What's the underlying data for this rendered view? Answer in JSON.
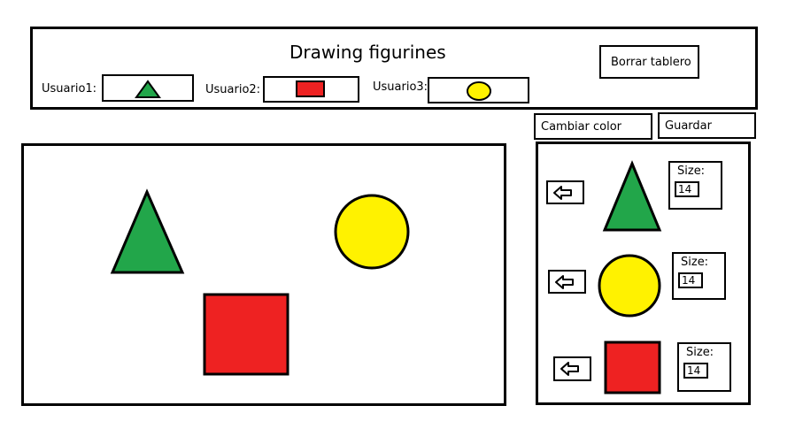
{
  "header": {
    "title": "Drawing figurines",
    "clear_button": "Borrar tablero",
    "users": [
      {
        "label": "Usuario1:",
        "shape": "triangle",
        "color": "#22A64A"
      },
      {
        "label": "Usuario2:",
        "shape": "square",
        "color": "#EE2222"
      },
      {
        "label": "Usuario3:",
        "shape": "circle",
        "color": "#FFF200"
      }
    ]
  },
  "toolbar": {
    "change_color_button": "Cambiar color",
    "save_button": "Guardar"
  },
  "canvas": {
    "shapes": [
      {
        "type": "triangle",
        "color": "#22A64A"
      },
      {
        "type": "circle",
        "color": "#FFF200"
      },
      {
        "type": "square",
        "color": "#EE2222"
      }
    ]
  },
  "palette": {
    "items": [
      {
        "shape": "triangle",
        "color": "#22A64A",
        "size_label": "Size:",
        "size_value": "14",
        "add_icon": "arrow-left-icon"
      },
      {
        "shape": "circle",
        "color": "#FFF200",
        "size_label": "Size:",
        "size_value": "14",
        "add_icon": "arrow-left-icon"
      },
      {
        "shape": "square",
        "color": "#EE2222",
        "size_label": "Size:",
        "size_value": "14",
        "add_icon": "arrow-left-icon"
      }
    ]
  },
  "colors": {
    "green": "#22A64A",
    "red": "#EE2222",
    "yellow": "#FFF200",
    "stroke": "#000000"
  }
}
